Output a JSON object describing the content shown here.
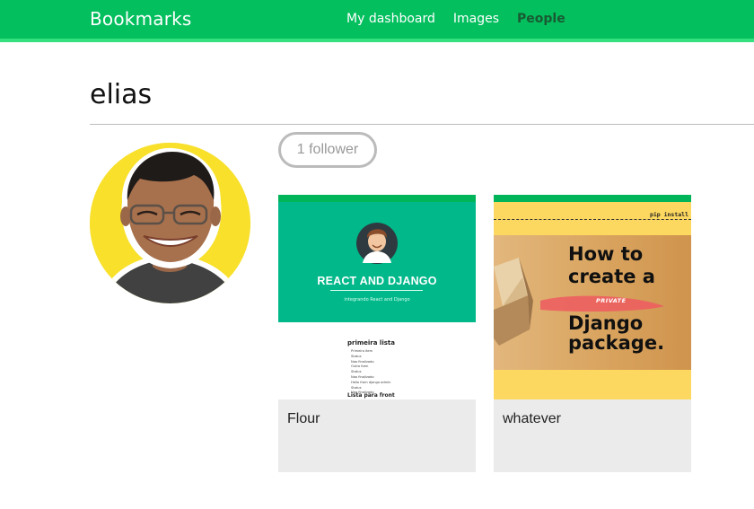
{
  "app": {
    "brand": "Bookmarks"
  },
  "nav": {
    "items": [
      {
        "label": "My dashboard",
        "active": false
      },
      {
        "label": "Images",
        "active": false
      },
      {
        "label": "People",
        "active": true
      }
    ]
  },
  "profile": {
    "username": "elias",
    "follow_button": "1 follower"
  },
  "images": [
    {
      "caption": "Flour",
      "thumbnail": {
        "heading": "REACT AND DJANGO",
        "subheading": "integrando React and Django",
        "list_title": "primeira lista",
        "list_items": [
          "Primeiro item",
          "Status",
          "Nao finalizado",
          "Outro Item",
          "Status",
          "Nao finalizado",
          "Hello from django admin",
          "Status",
          "Nao finalizado"
        ],
        "footer": "Lista para front"
      }
    },
    {
      "caption": "whatever",
      "thumbnail": {
        "command": "pip install",
        "line1": "How to",
        "line2": "create a",
        "highlight": "PRIVATE",
        "line3": "Django",
        "line4": "package."
      }
    }
  ],
  "colors": {
    "topbar": "#03bf5e",
    "topbar_border": "#35e07f",
    "active_nav": "#1a5a33",
    "avatar_bg": "#f8e02b",
    "card_bg": "#ebebeb"
  }
}
